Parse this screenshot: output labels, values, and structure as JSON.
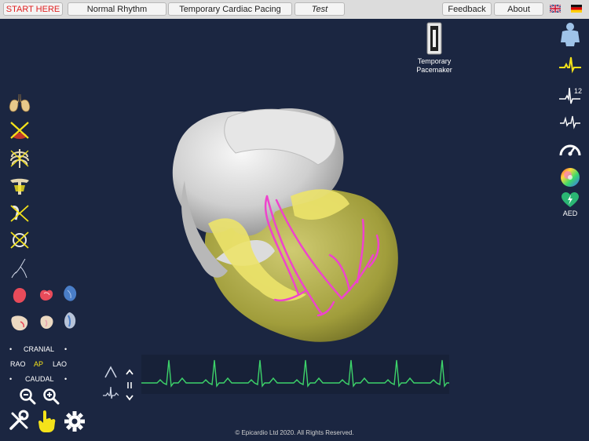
{
  "tabs": {
    "start": "START HERE",
    "normal_rhythm": "Normal Rhythm",
    "temporary_pacing": "Temporary Cardiac Pacing",
    "test": "Test",
    "feedback": "Feedback",
    "about": "About"
  },
  "pacemaker": {
    "label": "Temporary Pacemaker"
  },
  "right_toolbar": {
    "aed_label": "AED"
  },
  "views": {
    "cranial": "CRANIAL",
    "rao": "RAO",
    "ap": "AP",
    "lao": "LAO",
    "caudal": "CAUDAL"
  },
  "colors": {
    "accent_yellow": "#f4e21a",
    "start_red": "#e02020",
    "ecg_green": "#3dd36a",
    "background": "#1b2641"
  },
  "footer": {
    "copyright": "© Epicardio Ltd 2020. All Rights Reserved."
  }
}
